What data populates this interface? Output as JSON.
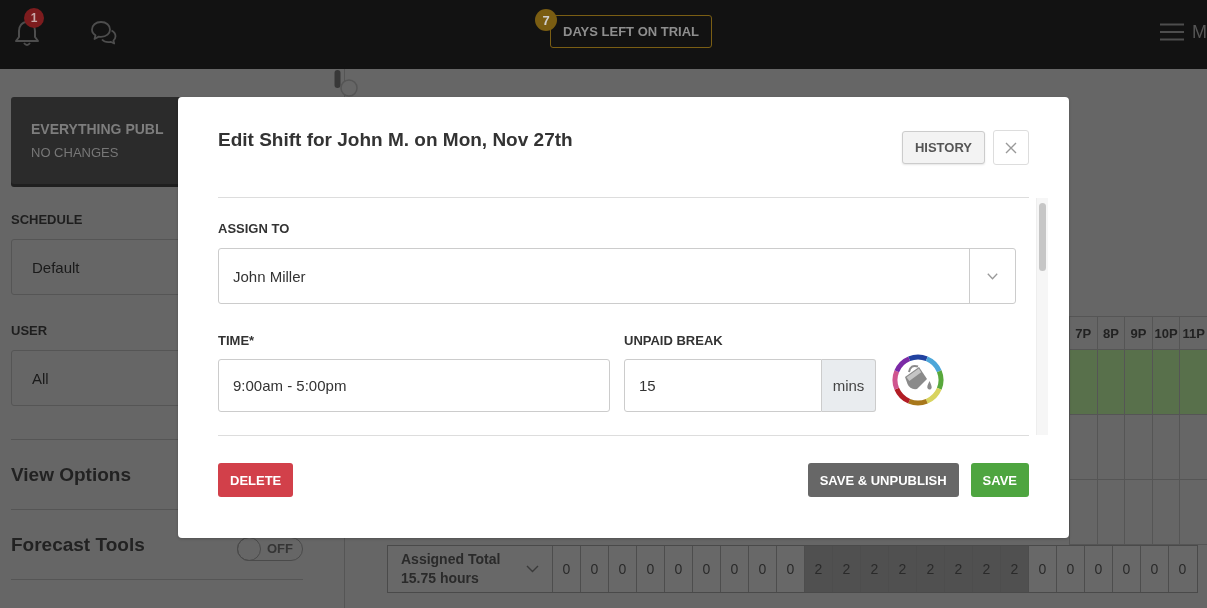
{
  "top_bar": {
    "notification_count": "1",
    "trial": {
      "days": "7",
      "label": "DAYS LEFT ON TRIAL"
    },
    "user_initial": "M"
  },
  "sidebar": {
    "publish_status": {
      "title": "EVERYTHING PUBL",
      "subtitle": "NO CHANGES"
    },
    "filters": [
      {
        "label": "SCHEDULE",
        "value": "Default"
      },
      {
        "label": "USER",
        "value": "All"
      }
    ],
    "sections": [
      {
        "kind": "header",
        "title": "View Options"
      },
      {
        "kind": "toggle",
        "title": "Forecast Tools",
        "toggle": {
          "on": false,
          "label": "OFF"
        }
      }
    ]
  },
  "schedule_grid": {
    "hours": [
      "7P",
      "8P",
      "9P",
      "10P",
      "11P"
    ],
    "rows": [
      {
        "highlighted": true
      },
      {
        "highlighted": false
      },
      {
        "highlighted": false
      }
    ],
    "totals": {
      "label": "Assigned Total",
      "hours": "15.75 hours",
      "cells": [
        {
          "value": "0",
          "shaded": false
        },
        {
          "value": "0",
          "shaded": false
        },
        {
          "value": "0",
          "shaded": false
        },
        {
          "value": "0",
          "shaded": false
        },
        {
          "value": "0",
          "shaded": false
        },
        {
          "value": "0",
          "shaded": false
        },
        {
          "value": "0",
          "shaded": false
        },
        {
          "value": "0",
          "shaded": false
        },
        {
          "value": "0",
          "shaded": false
        },
        {
          "value": "2",
          "shaded": true
        },
        {
          "value": "2",
          "shaded": true
        },
        {
          "value": "2",
          "shaded": true
        },
        {
          "value": "2",
          "shaded": true
        },
        {
          "value": "2",
          "shaded": true
        },
        {
          "value": "2",
          "shaded": true
        },
        {
          "value": "2",
          "shaded": true
        },
        {
          "value": "2",
          "shaded": true
        },
        {
          "value": "0",
          "shaded": false
        },
        {
          "value": "0",
          "shaded": false
        },
        {
          "value": "0",
          "shaded": false
        },
        {
          "value": "0",
          "shaded": false
        },
        {
          "value": "0",
          "shaded": false
        },
        {
          "value": "0",
          "shaded": false
        }
      ]
    }
  },
  "dialog": {
    "title": "Edit Shift for John M. on Mon, Nov 27th",
    "history_button": "HISTORY",
    "assign_to": {
      "label": "ASSIGN TO",
      "value": "John Miller"
    },
    "time": {
      "label": "TIME*",
      "value": "9:00am - 5:00pm"
    },
    "unpaid_break": {
      "label": "UNPAID BREAK",
      "value": "15",
      "unit": "mins"
    },
    "buttons": [
      {
        "label": "DELETE",
        "kind": "danger"
      },
      {
        "label": "SAVE & UNPUBLISH",
        "kind": "secondary"
      },
      {
        "label": "SAVE",
        "kind": "primary"
      }
    ]
  }
}
